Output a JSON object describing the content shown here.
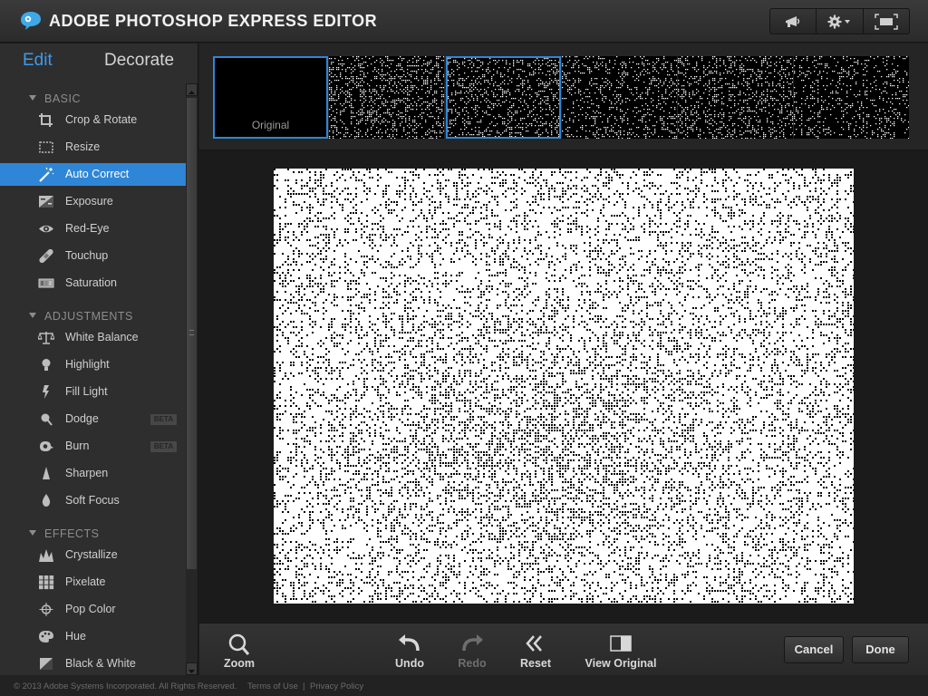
{
  "app": {
    "title": "ADOBE PHOTOSHOP EXPRESS EDITOR"
  },
  "titlebar": {
    "buttons": [
      "megaphone-icon",
      "gear-icon",
      "fullscreen-icon"
    ]
  },
  "modes": {
    "edit": "Edit",
    "decorate": "Decorate",
    "active": "Edit"
  },
  "sidebar": {
    "basic": {
      "title": "BASIC",
      "items": [
        {
          "label": "Crop & Rotate",
          "icon": "crop-icon"
        },
        {
          "label": "Resize",
          "icon": "resize-icon"
        },
        {
          "label": "Auto Correct",
          "icon": "magic-wand-icon",
          "selected": true
        },
        {
          "label": "Exposure",
          "icon": "exposure-icon"
        },
        {
          "label": "Red-Eye",
          "icon": "eye-icon"
        },
        {
          "label": "Touchup",
          "icon": "bandage-icon"
        },
        {
          "label": "Saturation",
          "icon": "saturation-icon"
        }
      ]
    },
    "adjustments": {
      "title": "ADJUSTMENTS",
      "items": [
        {
          "label": "White Balance",
          "icon": "balance-scale-icon"
        },
        {
          "label": "Highlight",
          "icon": "lightbulb-icon"
        },
        {
          "label": "Fill Light",
          "icon": "lightning-icon"
        },
        {
          "label": "Dodge",
          "icon": "dodge-icon",
          "badge": "BETA"
        },
        {
          "label": "Burn",
          "icon": "burn-icon",
          "badge": "BETA"
        },
        {
          "label": "Sharpen",
          "icon": "sharpen-icon"
        },
        {
          "label": "Soft Focus",
          "icon": "drop-icon"
        }
      ]
    },
    "effects": {
      "title": "EFFECTS",
      "items": [
        {
          "label": "Crystallize",
          "icon": "crystallize-icon"
        },
        {
          "label": "Pixelate",
          "icon": "pixelate-icon"
        },
        {
          "label": "Pop Color",
          "icon": "target-icon"
        },
        {
          "label": "Hue",
          "icon": "palette-icon"
        },
        {
          "label": "Black & White",
          "icon": "black-white-icon"
        }
      ]
    }
  },
  "filmstrip": {
    "original_label": "Original",
    "thumb_count": 6,
    "selected_index": 2
  },
  "toolbar": {
    "zoom": "Zoom",
    "undo": "Undo",
    "redo": "Redo",
    "reset": "Reset",
    "view_original": "View Original",
    "cancel": "Cancel",
    "done": "Done"
  },
  "footer": {
    "copyright": "© 2013 Adobe Systems Incorporated. All Rights Reserved.",
    "terms": "Terms of Use",
    "separator": "|",
    "privacy": "Privacy Policy"
  },
  "colors": {
    "accent": "#2f86d6",
    "edit_tab": "#3d9be9"
  }
}
